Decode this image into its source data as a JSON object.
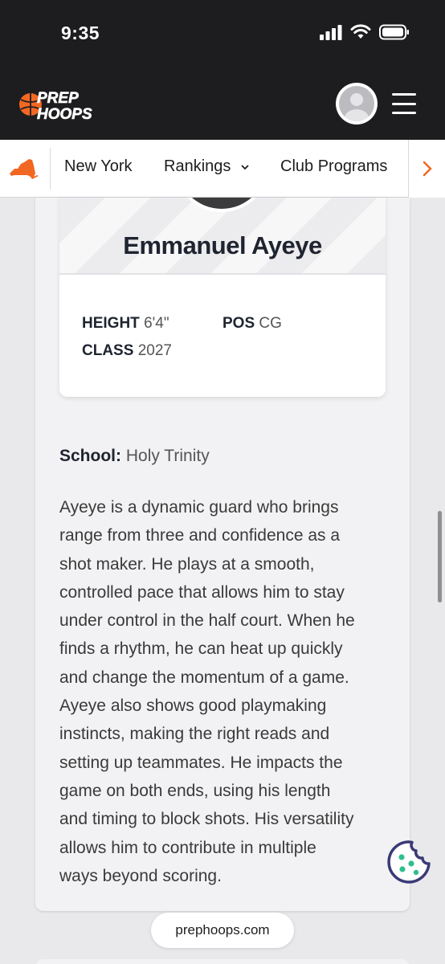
{
  "status_bar": {
    "time": "9:35"
  },
  "header": {
    "logo_top": "PREP",
    "logo_bottom": "HOOPS",
    "accent_color": "#f26722"
  },
  "nav": {
    "items": [
      {
        "label": "New York"
      },
      {
        "label": "Rankings",
        "has_dropdown": true
      },
      {
        "label": "Club Programs"
      }
    ]
  },
  "player": {
    "name": "Emmanuel Ayeye",
    "height_label": "HEIGHT",
    "height_value": "6'4\"",
    "pos_label": "POS",
    "pos_value": "CG",
    "class_label": "CLASS",
    "class_value": "2027"
  },
  "profile": {
    "school_label": "School:",
    "school_value": "Holy Trinity",
    "bio_lines": [
      "Ayeye is a dynamic guard who brings",
      "range from three and confidence as a",
      "shot maker. He plays at a smooth,",
      "controlled pace that allows him to stay",
      "under control in the half court. When he",
      "finds a rhythm, he can heat up quickly",
      "and change the momentum of a game.",
      "Ayeye also shows good playmaking",
      "instincts, making the right reads and",
      "setting up teammates. He impacts the",
      "game on both ends, using his length",
      "and timing to block shots. His versatility",
      "allows him to contribute in multiple",
      "ways beyond scoring."
    ]
  },
  "browser": {
    "url": "prephoops.com"
  },
  "icons": {
    "state": "new-york-state-icon",
    "avatar": "user-avatar-icon",
    "menu": "hamburger-menu-icon",
    "chevron_down": "chevron-down-icon",
    "chevron_right": "chevron-right-icon",
    "cookie": "cookie-icon"
  }
}
